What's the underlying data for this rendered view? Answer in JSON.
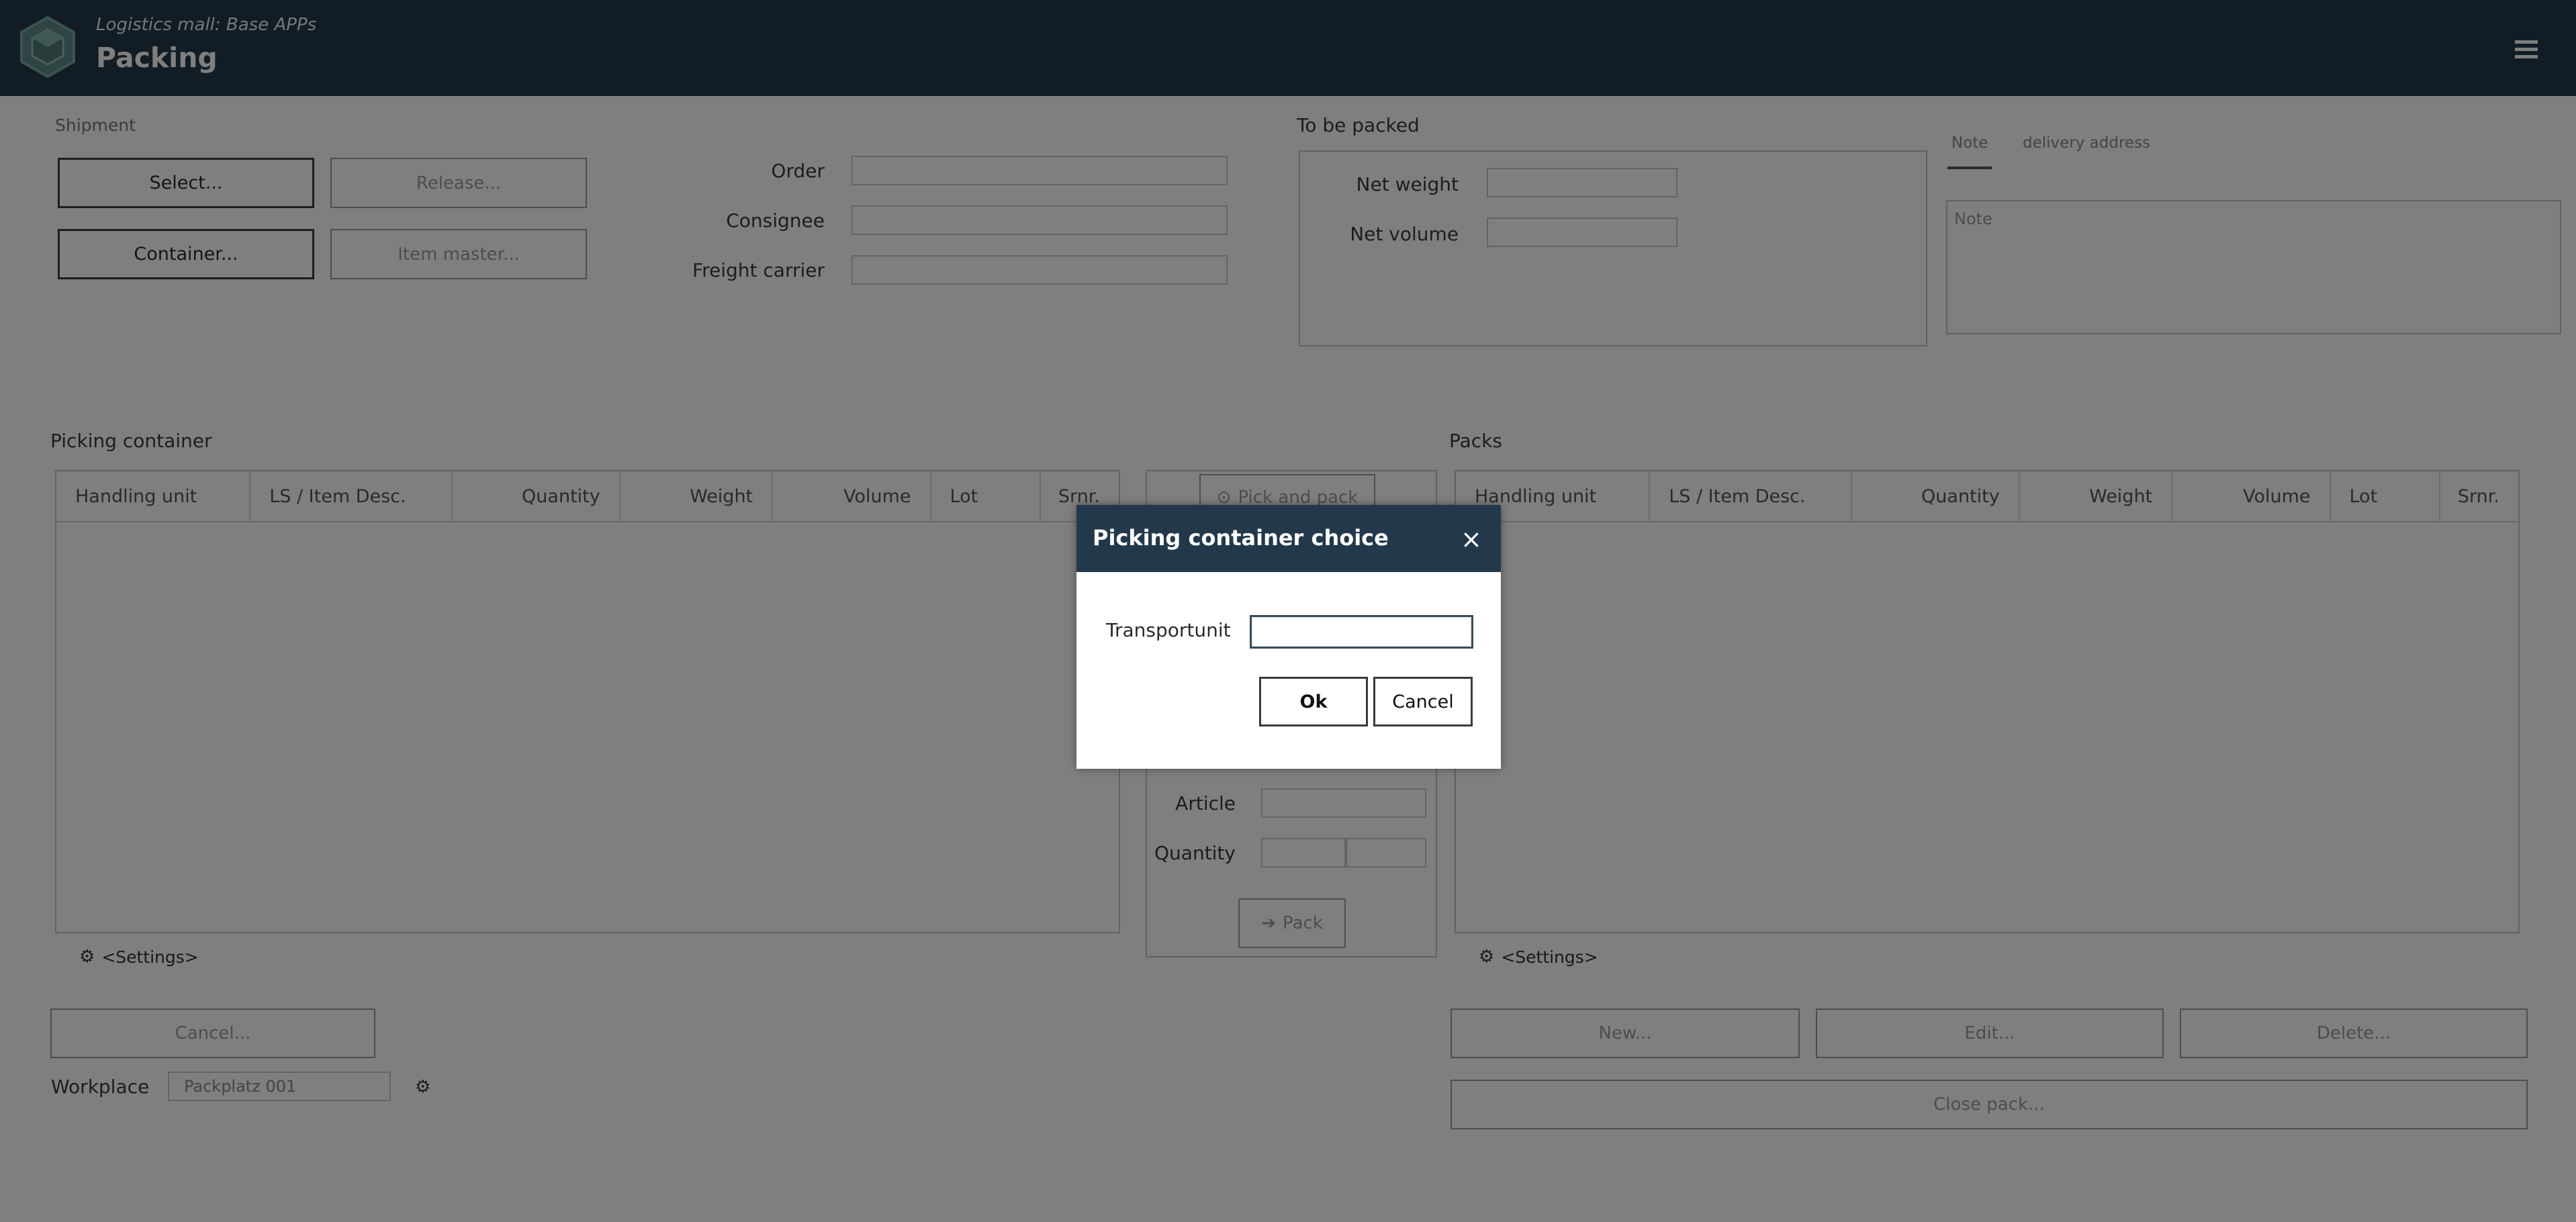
{
  "header": {
    "subtitle": "Logistics mall: Base APPs",
    "title": "Packing"
  },
  "shipment": {
    "section_label": "Shipment",
    "select_label": "Select...",
    "release_label": "Release...",
    "container_label": "Container...",
    "item_master_label": "Item master...",
    "order_label": "Order",
    "order_value": "",
    "consignee_label": "Consignee",
    "consignee_value": "",
    "freight_carrier_label": "Freight carrier",
    "freight_carrier_value": ""
  },
  "to_be_packed": {
    "section_label": "To be packed",
    "net_weight_label": "Net weight",
    "net_weight_value": "",
    "net_volume_label": "Net volume",
    "net_volume_value": ""
  },
  "note_panel": {
    "tabs": [
      "Note",
      "delivery address"
    ],
    "active_tab": "Note",
    "note_placeholder": "Note"
  },
  "picking_container": {
    "section_label": "Picking container",
    "columns": [
      "Handling unit",
      "LS / Item Desc.",
      "Quantity",
      "Weight",
      "Volume",
      "Lot",
      "Srnr."
    ],
    "rows": [],
    "settings_label": "<Settings>"
  },
  "middle_panel": {
    "pick_and_pack_label": "Pick and pack",
    "article_label": "Article",
    "article_value": "",
    "quantity_label": "Quantity",
    "pack_label": "Pack"
  },
  "packs": {
    "section_label": "Packs",
    "columns": [
      "Handling unit",
      "LS / Item Desc.",
      "Quantity",
      "Weight",
      "Volume",
      "Lot",
      "Srnr."
    ],
    "rows": [],
    "settings_label": "<Settings>",
    "new_label": "New...",
    "edit_label": "Edit...",
    "delete_label": "Delete...",
    "close_pack_label": "Close pack..."
  },
  "footer": {
    "cancel_label": "Cancel...",
    "workplace_label": "Workplace",
    "workplace_value": "Packplatz 001"
  },
  "dialog": {
    "title": "Picking container choice",
    "close_symbol": "×",
    "transportunit_label": "Transportunit",
    "transportunit_value": "",
    "ok_label": "Ok",
    "cancel_label": "Cancel"
  },
  "colors": {
    "header_bg": "#23394b",
    "overlay": "rgba(0,0,0,0.5)"
  }
}
